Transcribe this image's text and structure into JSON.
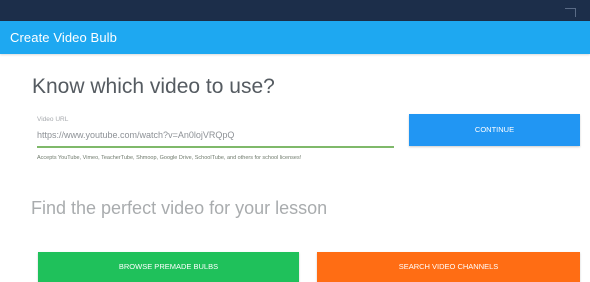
{
  "dialog": {
    "title": "Create Video Bulb"
  },
  "main": {
    "heading": "Know which video to use?",
    "video_url": {
      "label": "Video URL",
      "value": "https://www.youtube.com/watch?v=An0lojVRQpQ"
    },
    "help_text": "Accepts YouTube, Vimeo, TeacherTube, Shmoop, Google Drive, SchoolTube, and others for school licenses!",
    "continue_label": "CONTINUE",
    "heading2": "Find the perfect video for your lesson",
    "browse_label": "BROWSE PREMADE BULBS",
    "search_label": "SEARCH VIDEO CHANNELS"
  },
  "colors": {
    "header": "#1ea8f1",
    "continue": "#2196f3",
    "browse": "#1fc15b",
    "search": "#ff6d14",
    "input_underline": "#7fb96a"
  }
}
